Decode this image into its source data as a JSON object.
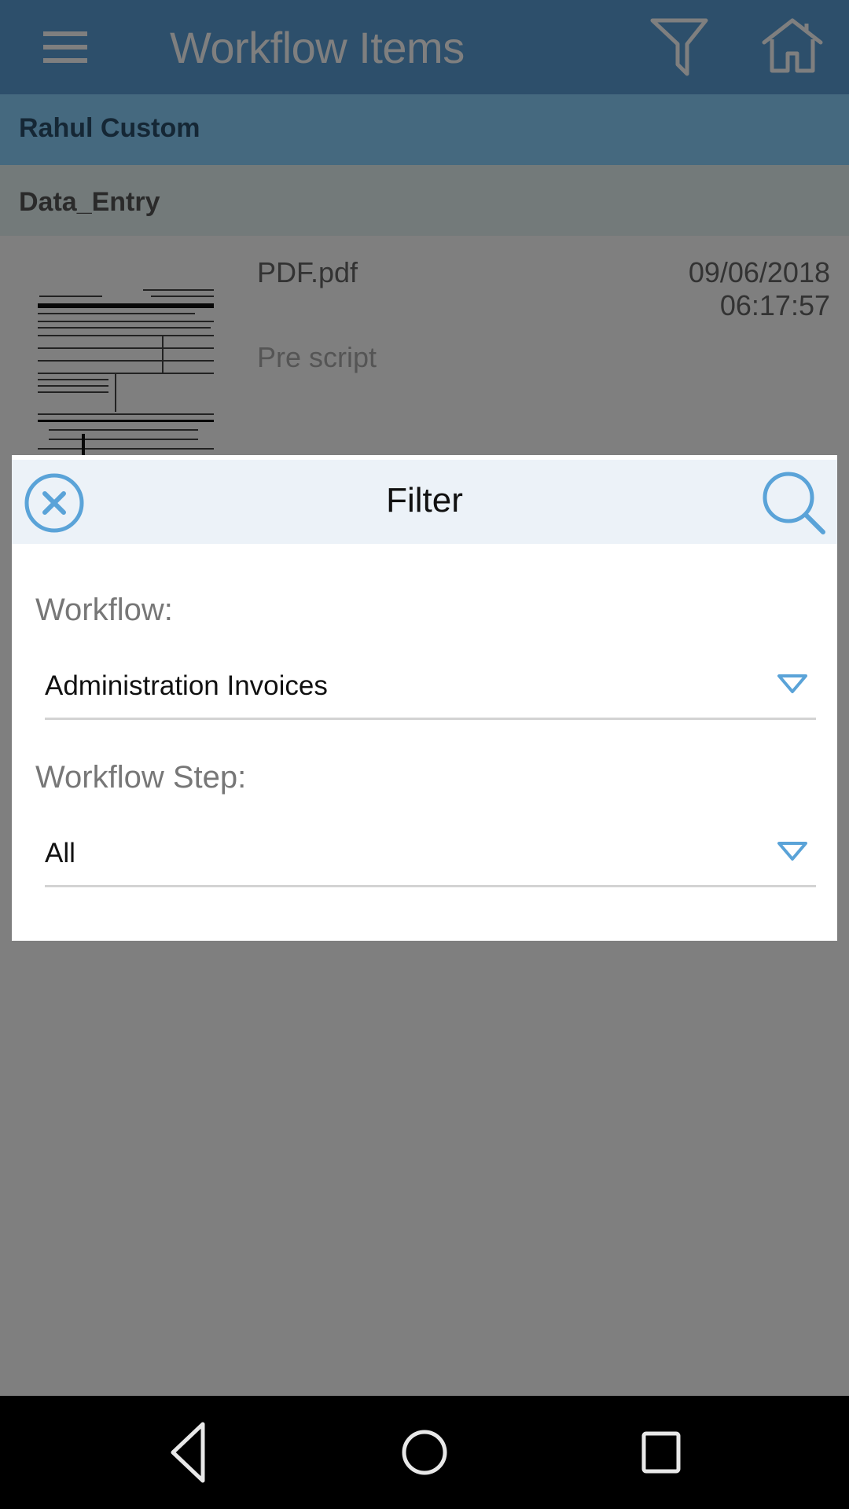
{
  "app_bar": {
    "title": "Workflow Items",
    "menu_icon": "hamburger-menu-icon",
    "filter_icon": "filter-funnel-icon",
    "home_icon": "home-icon"
  },
  "list": {
    "group_header": "Rahul Custom",
    "step_header": "Data_Entry",
    "items": [
      {
        "name": "PDF.pdf",
        "step": "Pre script",
        "date": "09/06/2018",
        "time": "06:17:57",
        "thumbnail": "document-thumbnail"
      }
    ]
  },
  "filter_dialog": {
    "title": "Filter",
    "close_icon": "close-circle-icon",
    "search_icon": "search-icon",
    "fields": [
      {
        "label": "Workflow:",
        "value": "Administration Invoices"
      },
      {
        "label": "Workflow Step:",
        "value": "All"
      }
    ]
  },
  "nav_bar": {
    "back_icon": "back-triangle-icon",
    "home_icon": "home-circle-icon",
    "recents_icon": "recents-square-icon"
  },
  "colors": {
    "app_bar": "#5a9fd6",
    "group_band": "#8bd3ff",
    "accent": "#5a9fd6",
    "dialog_header": "#ecf2f8",
    "scrim": "rgba(0,0,0,0.5)"
  }
}
